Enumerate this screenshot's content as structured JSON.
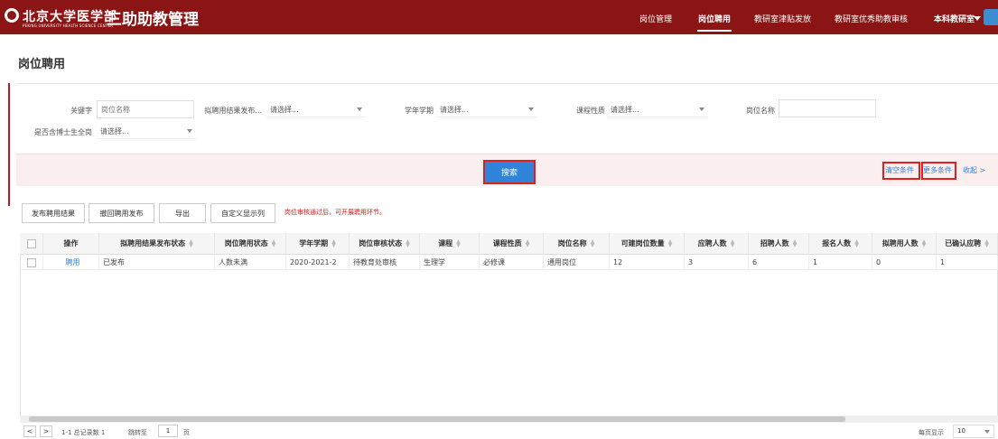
{
  "header": {
    "logo_cn": "北京大学医学部",
    "logo_en": "PEKING UNIVERSITY HEALTH SCIENCE CENTER",
    "app_title": "三助助教管理",
    "nav": [
      "岗位管理",
      "岗位聘用",
      "教研室津贴发放",
      "教研室优秀助教审核"
    ],
    "active_nav": "岗位聘用",
    "role": "本科教研室",
    "bar_color": "#8b1414"
  },
  "page": {
    "title": "岗位聘用"
  },
  "filters": {
    "keyword_label": "关键字",
    "keyword_placeholder": "岗位名称",
    "publish_status_label": "拟聘用结果发布...",
    "publish_status_value": "请选择...",
    "term_label": "学年学期",
    "term_value": "请选择...",
    "course_type_label": "课程性质",
    "course_type_value": "请选择...",
    "position_name_label": "岗位名称",
    "position_name_value": "",
    "phd_label": "是否含博士生全岗",
    "phd_value": "请选择...",
    "search_btn": "搜索",
    "clear_btn": "清空条件",
    "more_btn": "更多条件",
    "collapse_btn": "收起 >"
  },
  "toolbar": {
    "publish": "发布聘用结果",
    "withdraw": "撤回聘用发布",
    "export": "导出",
    "custom_cols": "自定义显示列",
    "note": "岗位审核通过后，可开展聘用环节。"
  },
  "table": {
    "columns": [
      "操作",
      "拟聘用结果发布状态",
      "岗位聘用状态",
      "学年学期",
      "岗位审核状态",
      "课程",
      "课程性质",
      "岗位名称",
      "可建岗位数量",
      "应聘人数",
      "招聘人数",
      "报名人数",
      "拟聘用人数",
      "已确认应聘"
    ],
    "rows": [
      [
        "聘用",
        "已发布",
        "人数未满",
        "2020-2021-2",
        "待教育处审核",
        "生理学",
        "必修课",
        "通用岗位",
        "12",
        "3",
        "6",
        "1",
        "0",
        "1"
      ]
    ]
  },
  "pagination": {
    "summary": "1-1 总记录数 1",
    "jump_label": "跳转至",
    "page_value": "1",
    "page_unit": "页",
    "per_page_label": "每页显示",
    "per_page_value": "10"
  }
}
